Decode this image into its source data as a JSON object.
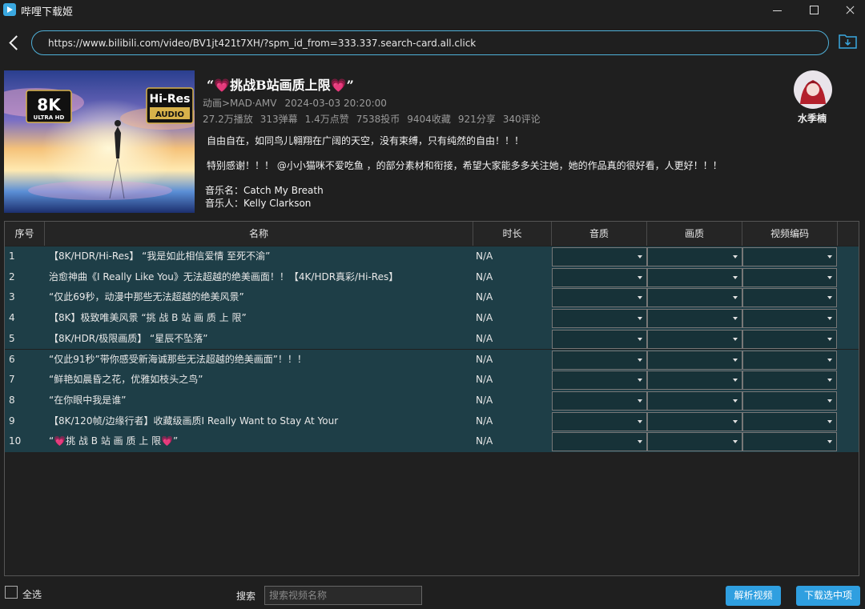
{
  "window": {
    "title": "哔哩下载姬"
  },
  "url_bar": {
    "value": "https://www.bilibili.com/video/BV1jt421t7XH/?spm_id_from=333.337.search-card.all.click"
  },
  "video": {
    "title": "“💗挑战B站画质上限💗”",
    "category": "动画>MAD·AMV",
    "date": "2024-03-03 20:20:00",
    "stats": {
      "plays": "27.2万播放",
      "danmaku": "313弹幕",
      "likes": "1.4万点赞",
      "coins": "7538投币",
      "favorites": "9404收藏",
      "shares": "921分享",
      "comments": "340评论"
    },
    "description_line1": "自由自在，如同鸟儿翱翔在广阔的天空，没有束缚，只有纯然的自由！！！",
    "description_line2": "特别感谢！！！ @小小猫咪不爱吃鱼 ，的部分素材和衔接，希望大家能多多关注她，她的作品真的很好看，人更好！！！",
    "music_name": "音乐名：Catch My Breath",
    "music_artist": "音乐人：Kelly Clarkson",
    "cover_badges": {
      "left": "8K",
      "left_sub": "ULTRA HD",
      "right": "Hi-Res",
      "right_sub": "AUDIO"
    }
  },
  "uploader": {
    "name": "水季楠"
  },
  "table": {
    "headers": {
      "index": "序号",
      "name": "名称",
      "duration": "时长",
      "audio_quality": "音质",
      "video_quality": "画质",
      "video_codec": "视频编码"
    },
    "rows": [
      {
        "index": "1",
        "name": "【8K/HDR/Hi-Res】 “我是如此相信爱情 至死不渝”",
        "duration": "N/A"
      },
      {
        "index": "2",
        "name": "治愈神曲《I Really Like You》无法超越的绝美画面！！【4K/HDR真彩/Hi-Res】",
        "duration": "N/A"
      },
      {
        "index": "3",
        "name": "“仅此69秒，动漫中那些无法超越的绝美风景”",
        "duration": "N/A"
      },
      {
        "index": "4",
        "name": "【8K】极致唯美风景 “挑 战 B 站 画 质 上 限”",
        "duration": "N/A"
      },
      {
        "index": "5",
        "name": "【8K/HDR/极限画质】 “星辰不坠落”",
        "duration": "N/A"
      },
      {
        "index": "6",
        "name": "“仅此91秒”带你感受新海诚那些无法超越的绝美画面”！！！",
        "duration": "N/A"
      },
      {
        "index": "7",
        "name": "“鲜艳如晨昏之花，优雅如枝头之鸟”",
        "duration": "N/A"
      },
      {
        "index": "8",
        "name": "“在你眼中我是谁”",
        "duration": "N/A"
      },
      {
        "index": "9",
        "name": "【8K/120帧/边缘行者】收藏级画质I Really Want to Stay At Your",
        "duration": "N/A"
      },
      {
        "index": "10",
        "name": "“💗挑 战 B 站 画 质 上 限💗”",
        "duration": "N/A"
      }
    ]
  },
  "footer": {
    "select_all_label": "全选",
    "search_label": "搜索",
    "search_placeholder": "搜索视频名称",
    "parse_button": "解析视频",
    "download_button": "下载选中项"
  },
  "colors": {
    "accent": "#2f9fe0",
    "row_bg": "#1e3e47",
    "background": "#1f1f1f"
  }
}
